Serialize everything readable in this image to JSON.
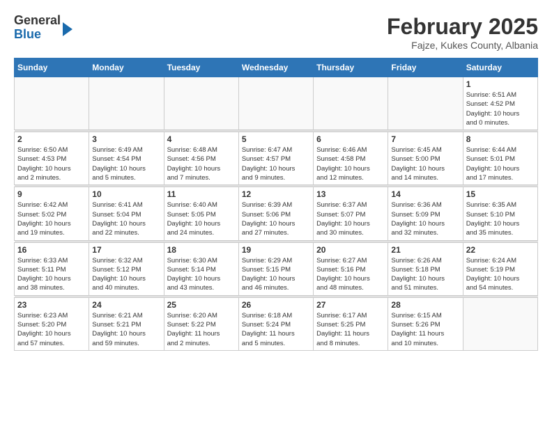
{
  "logo": {
    "general": "General",
    "blue": "Blue"
  },
  "header": {
    "month_year": "February 2025",
    "location": "Fajze, Kukes County, Albania"
  },
  "weekdays": [
    "Sunday",
    "Monday",
    "Tuesday",
    "Wednesday",
    "Thursday",
    "Friday",
    "Saturday"
  ],
  "weeks": [
    [
      {
        "day": "",
        "info": ""
      },
      {
        "day": "",
        "info": ""
      },
      {
        "day": "",
        "info": ""
      },
      {
        "day": "",
        "info": ""
      },
      {
        "day": "",
        "info": ""
      },
      {
        "day": "",
        "info": ""
      },
      {
        "day": "1",
        "info": "Sunrise: 6:51 AM\nSunset: 4:52 PM\nDaylight: 10 hours\nand 0 minutes."
      }
    ],
    [
      {
        "day": "2",
        "info": "Sunrise: 6:50 AM\nSunset: 4:53 PM\nDaylight: 10 hours\nand 2 minutes."
      },
      {
        "day": "3",
        "info": "Sunrise: 6:49 AM\nSunset: 4:54 PM\nDaylight: 10 hours\nand 5 minutes."
      },
      {
        "day": "4",
        "info": "Sunrise: 6:48 AM\nSunset: 4:56 PM\nDaylight: 10 hours\nand 7 minutes."
      },
      {
        "day": "5",
        "info": "Sunrise: 6:47 AM\nSunset: 4:57 PM\nDaylight: 10 hours\nand 9 minutes."
      },
      {
        "day": "6",
        "info": "Sunrise: 6:46 AM\nSunset: 4:58 PM\nDaylight: 10 hours\nand 12 minutes."
      },
      {
        "day": "7",
        "info": "Sunrise: 6:45 AM\nSunset: 5:00 PM\nDaylight: 10 hours\nand 14 minutes."
      },
      {
        "day": "8",
        "info": "Sunrise: 6:44 AM\nSunset: 5:01 PM\nDaylight: 10 hours\nand 17 minutes."
      }
    ],
    [
      {
        "day": "9",
        "info": "Sunrise: 6:42 AM\nSunset: 5:02 PM\nDaylight: 10 hours\nand 19 minutes."
      },
      {
        "day": "10",
        "info": "Sunrise: 6:41 AM\nSunset: 5:04 PM\nDaylight: 10 hours\nand 22 minutes."
      },
      {
        "day": "11",
        "info": "Sunrise: 6:40 AM\nSunset: 5:05 PM\nDaylight: 10 hours\nand 24 minutes."
      },
      {
        "day": "12",
        "info": "Sunrise: 6:39 AM\nSunset: 5:06 PM\nDaylight: 10 hours\nand 27 minutes."
      },
      {
        "day": "13",
        "info": "Sunrise: 6:37 AM\nSunset: 5:07 PM\nDaylight: 10 hours\nand 30 minutes."
      },
      {
        "day": "14",
        "info": "Sunrise: 6:36 AM\nSunset: 5:09 PM\nDaylight: 10 hours\nand 32 minutes."
      },
      {
        "day": "15",
        "info": "Sunrise: 6:35 AM\nSunset: 5:10 PM\nDaylight: 10 hours\nand 35 minutes."
      }
    ],
    [
      {
        "day": "16",
        "info": "Sunrise: 6:33 AM\nSunset: 5:11 PM\nDaylight: 10 hours\nand 38 minutes."
      },
      {
        "day": "17",
        "info": "Sunrise: 6:32 AM\nSunset: 5:12 PM\nDaylight: 10 hours\nand 40 minutes."
      },
      {
        "day": "18",
        "info": "Sunrise: 6:30 AM\nSunset: 5:14 PM\nDaylight: 10 hours\nand 43 minutes."
      },
      {
        "day": "19",
        "info": "Sunrise: 6:29 AM\nSunset: 5:15 PM\nDaylight: 10 hours\nand 46 minutes."
      },
      {
        "day": "20",
        "info": "Sunrise: 6:27 AM\nSunset: 5:16 PM\nDaylight: 10 hours\nand 48 minutes."
      },
      {
        "day": "21",
        "info": "Sunrise: 6:26 AM\nSunset: 5:18 PM\nDaylight: 10 hours\nand 51 minutes."
      },
      {
        "day": "22",
        "info": "Sunrise: 6:24 AM\nSunset: 5:19 PM\nDaylight: 10 hours\nand 54 minutes."
      }
    ],
    [
      {
        "day": "23",
        "info": "Sunrise: 6:23 AM\nSunset: 5:20 PM\nDaylight: 10 hours\nand 57 minutes."
      },
      {
        "day": "24",
        "info": "Sunrise: 6:21 AM\nSunset: 5:21 PM\nDaylight: 10 hours\nand 59 minutes."
      },
      {
        "day": "25",
        "info": "Sunrise: 6:20 AM\nSunset: 5:22 PM\nDaylight: 11 hours\nand 2 minutes."
      },
      {
        "day": "26",
        "info": "Sunrise: 6:18 AM\nSunset: 5:24 PM\nDaylight: 11 hours\nand 5 minutes."
      },
      {
        "day": "27",
        "info": "Sunrise: 6:17 AM\nSunset: 5:25 PM\nDaylight: 11 hours\nand 8 minutes."
      },
      {
        "day": "28",
        "info": "Sunrise: 6:15 AM\nSunset: 5:26 PM\nDaylight: 11 hours\nand 10 minutes."
      },
      {
        "day": "",
        "info": ""
      }
    ]
  ]
}
